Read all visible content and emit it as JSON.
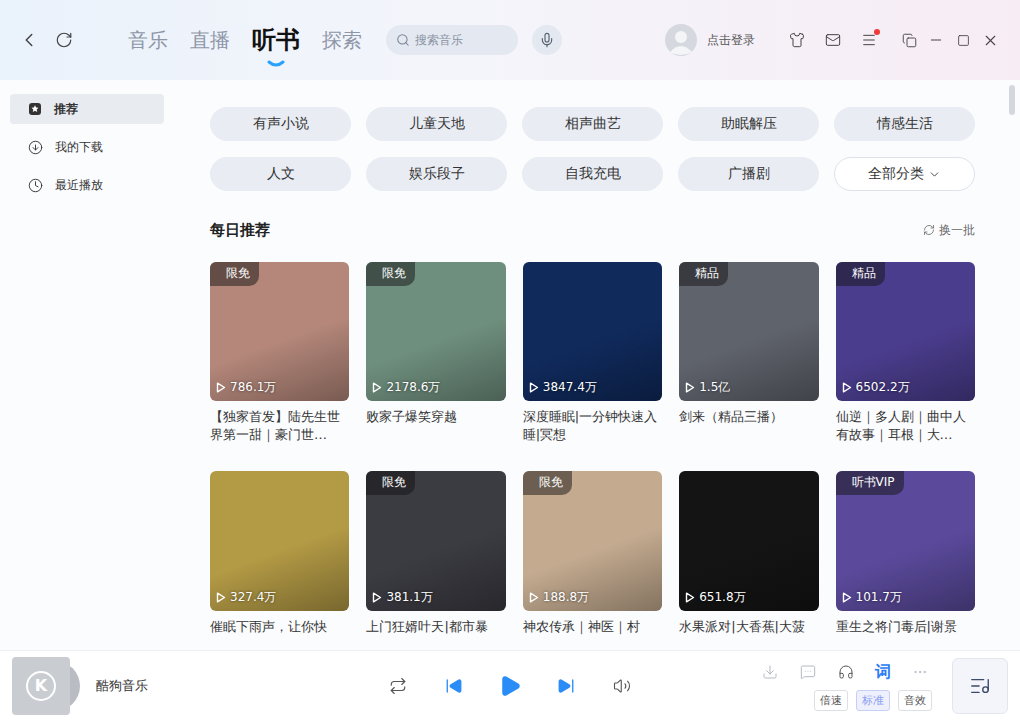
{
  "nav": {
    "tabs": [
      {
        "label": "音乐",
        "selected": false
      },
      {
        "label": "直播",
        "selected": false
      },
      {
        "label": "听书",
        "selected": true
      },
      {
        "label": "探索",
        "selected": false
      }
    ]
  },
  "search": {
    "placeholder": "搜索音乐"
  },
  "account": {
    "login": "点击登录"
  },
  "notifications": {
    "menu_dot": true
  },
  "sidebar": {
    "items": [
      {
        "label": "推荐",
        "selected": true,
        "kind": "recommend"
      },
      {
        "label": "我的下载",
        "selected": false,
        "kind": "download"
      },
      {
        "label": "最近播放",
        "selected": false,
        "kind": "recent"
      }
    ]
  },
  "categories": [
    {
      "label": "有声小说",
      "kind": "pill"
    },
    {
      "label": "儿童天地",
      "kind": "pill"
    },
    {
      "label": "相声曲艺",
      "kind": "pill"
    },
    {
      "label": "助眠解压",
      "kind": "pill"
    },
    {
      "label": "情感生活",
      "kind": "pill"
    },
    {
      "label": "人文",
      "kind": "pill"
    },
    {
      "label": "娱乐段子",
      "kind": "pill"
    },
    {
      "label": "自我充电",
      "kind": "pill"
    },
    {
      "label": "广播剧",
      "kind": "pill"
    },
    {
      "label": "全部分类",
      "kind": "dropdown"
    }
  ],
  "daily": {
    "title": "每日推荐",
    "refresh": "换一批",
    "cards": [
      {
        "title": "【独家首发】陆先生世界第一甜｜豪门世…",
        "plays": "786.1万",
        "badge": "限免",
        "color": "#b4877a"
      },
      {
        "title": "败家子爆笑穿越",
        "plays": "2178.6万",
        "badge": "限免",
        "color": "#6f8f7e"
      },
      {
        "title": "深度睡眠|一分钟快速入睡|冥想",
        "plays": "3847.4万",
        "badge": null,
        "color": "#102a5c"
      },
      {
        "title": "剑来（精品三播）",
        "plays": "1.5亿",
        "badge": "精品",
        "color": "#5f636c"
      },
      {
        "title": "仙逆｜多人剧｜曲中人有故事｜耳根｜大…",
        "plays": "6502.2万",
        "badge": "精品",
        "color": "#4b3d8e"
      },
      {
        "title": "催眠下雨声，让你快",
        "plays": "327.4万",
        "badge": null,
        "color": "#b39a45"
      },
      {
        "title": "上门狂婿叶天|都市暴",
        "plays": "381.1万",
        "badge": "限免",
        "color": "#3b3b42"
      },
      {
        "title": "神农传承｜神医｜村",
        "plays": "188.8万",
        "badge": "限免",
        "color": "#c4ab90"
      },
      {
        "title": "水果派对|大香蕉|大菠",
        "plays": "651.8万",
        "badge": null,
        "color": "#141414"
      },
      {
        "title": "重生之将门毒后|谢景",
        "plays": "101.7万",
        "badge": "听书VIP",
        "color": "#5b4a9c"
      }
    ]
  },
  "scrollbar": {
    "level": 0
  },
  "player": {
    "logo": "K",
    "track": "酷狗音乐",
    "playing": false,
    "lyrics": "词",
    "options": [
      {
        "label": "倍速",
        "selected": false
      },
      {
        "label": "标准",
        "selected": true
      },
      {
        "label": "音效",
        "selected": false
      }
    ]
  }
}
